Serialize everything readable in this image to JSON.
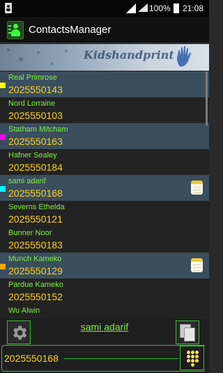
{
  "status_bar": {
    "battery_percent": "100%",
    "time": "21:08"
  },
  "app": {
    "title": "ContactsManager",
    "banner_text": "Kidshandprint"
  },
  "contacts": [
    {
      "name": "Real Primrose",
      "phone": "2025550143",
      "selected": true,
      "marker_color": "#ffff00",
      "has_note": false
    },
    {
      "name": "Nord Lorraine",
      "phone": "2025550103",
      "selected": false,
      "marker_color": "",
      "has_note": false
    },
    {
      "name": "Statham Mitcham",
      "phone": "2025550163",
      "selected": true,
      "marker_color": "#ff00ff",
      "has_note": false
    },
    {
      "name": "Hafner Sealey",
      "phone": "2025550184",
      "selected": false,
      "marker_color": "",
      "has_note": false
    },
    {
      "name": "sami adarif",
      "phone": "2025550168",
      "selected": true,
      "marker_color": "#00ffff",
      "has_note": true
    },
    {
      "name": "Severns Ethelda",
      "phone": "2025550121",
      "selected": false,
      "marker_color": "",
      "has_note": false
    },
    {
      "name": "Bunner Noor",
      "phone": "2025550183",
      "selected": false,
      "marker_color": "",
      "has_note": false
    },
    {
      "name": "Munch Kameko",
      "phone": "2025550129",
      "selected": true,
      "marker_color": "#ffa500",
      "has_note": true
    },
    {
      "name": "Pardue Kameko",
      "phone": "2025550152",
      "selected": false,
      "marker_color": "",
      "has_note": false
    },
    {
      "name": "Wu Alwin",
      "phone": "",
      "selected": false,
      "marker_color": "",
      "has_note": false
    }
  ],
  "bottom": {
    "selected_name": "sami adarif",
    "dial_number": "2025550168"
  },
  "icons": {
    "settings": "gear-icon",
    "copy": "copy-icon",
    "dialpad": "dialpad-icon",
    "note": "note-icon"
  },
  "colors": {
    "name_text": "#7cf23a",
    "phone_text": "#ffd21a",
    "selected_row": "#3a4e5e",
    "accent_border": "#3cbf3c"
  }
}
